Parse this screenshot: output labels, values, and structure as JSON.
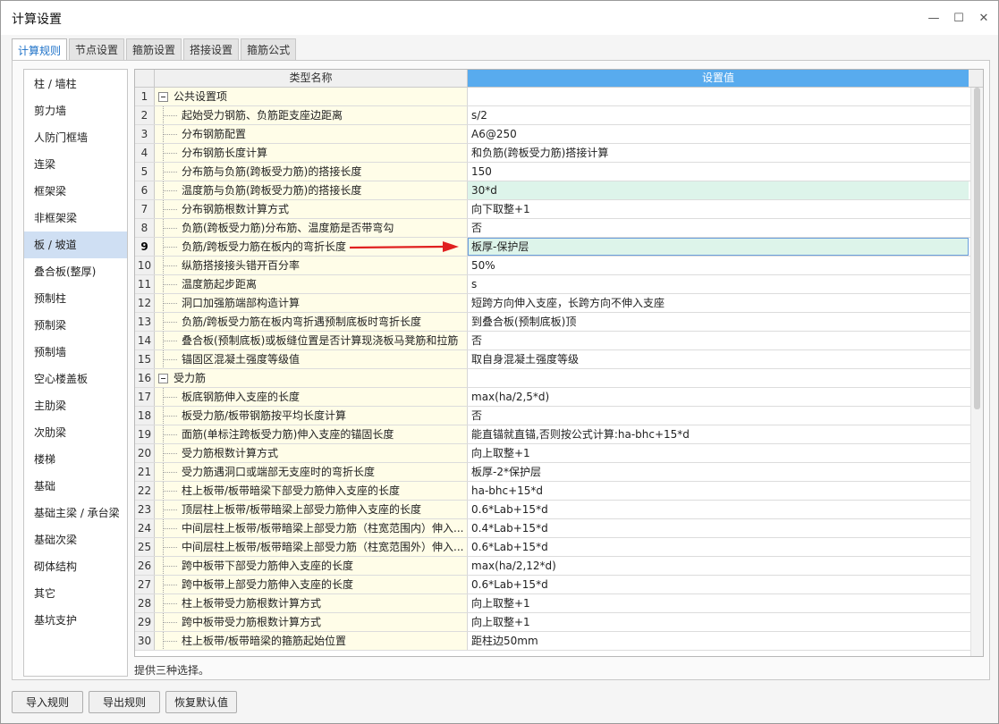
{
  "window": {
    "title": "计算设置",
    "minimize": "—",
    "maximize": "☐",
    "close": "✕"
  },
  "tabs": [
    {
      "label": "计算规则",
      "active": true
    },
    {
      "label": "节点设置",
      "active": false
    },
    {
      "label": "箍筋设置",
      "active": false
    },
    {
      "label": "搭接设置",
      "active": false
    },
    {
      "label": "箍筋公式",
      "active": false
    }
  ],
  "sidebar": {
    "items": [
      "柱 / 墙柱",
      "剪力墙",
      "人防门框墙",
      "连梁",
      "框架梁",
      "非框架梁",
      "板 / 坡道",
      "叠合板(整厚)",
      "预制柱",
      "预制梁",
      "预制墙",
      "空心楼盖板",
      "主肋梁",
      "次肋梁",
      "楼梯",
      "基础",
      "基础主梁 / 承台梁",
      "基础次梁",
      "砌体结构",
      "其它",
      "基坑支护"
    ],
    "active_index": 6
  },
  "grid": {
    "header_name": "类型名称",
    "header_value": "设置值",
    "rows": [
      {
        "num": "1",
        "name": "公共设置项",
        "value": "",
        "group": true
      },
      {
        "num": "2",
        "name": "起始受力钢筋、负筋距支座边距离",
        "value": "s/2"
      },
      {
        "num": "3",
        "name": "分布钢筋配置",
        "value": "A6@250"
      },
      {
        "num": "4",
        "name": "分布钢筋长度计算",
        "value": "和负筋(跨板受力筋)搭接计算"
      },
      {
        "num": "5",
        "name": "分布筋与负筋(跨板受力筋)的搭接长度",
        "value": "150"
      },
      {
        "num": "6",
        "name": "温度筋与负筋(跨板受力筋)的搭接长度",
        "value": "30*d",
        "highlight": true
      },
      {
        "num": "7",
        "name": "分布钢筋根数计算方式",
        "value": "向下取整+1"
      },
      {
        "num": "8",
        "name": "负筋(跨板受力筋)分布筋、温度筋是否带弯勾",
        "value": "否"
      },
      {
        "num": "9",
        "name": "负筋/跨板受力筋在板内的弯折长度",
        "value": "板厚-保护层",
        "selected": true
      },
      {
        "num": "10",
        "name": "纵筋搭接接头错开百分率",
        "value": "50%"
      },
      {
        "num": "11",
        "name": "温度筋起步距离",
        "value": "s"
      },
      {
        "num": "12",
        "name": "洞口加强筋端部构造计算",
        "value": "短跨方向伸入支座，长跨方向不伸入支座"
      },
      {
        "num": "13",
        "name": "负筋/跨板受力筋在板内弯折遇预制底板时弯折长度",
        "value": "到叠合板(预制底板)顶"
      },
      {
        "num": "14",
        "name": "叠合板(预制底板)或板缝位置是否计算现浇板马凳筋和拉筋",
        "value": "否"
      },
      {
        "num": "15",
        "name": "锚固区混凝土强度等级值",
        "value": "取自身混凝土强度等级"
      },
      {
        "num": "16",
        "name": "受力筋",
        "value": "",
        "group": true
      },
      {
        "num": "17",
        "name": "板底钢筋伸入支座的长度",
        "value": "max(ha/2,5*d)"
      },
      {
        "num": "18",
        "name": "板受力筋/板带钢筋按平均长度计算",
        "value": "否"
      },
      {
        "num": "19",
        "name": "面筋(单标注跨板受力筋)伸入支座的锚固长度",
        "value": "能直锚就直锚,否则按公式计算:ha-bhc+15*d"
      },
      {
        "num": "20",
        "name": "受力筋根数计算方式",
        "value": "向上取整+1"
      },
      {
        "num": "21",
        "name": "受力筋遇洞口或端部无支座时的弯折长度",
        "value": "板厚-2*保护层"
      },
      {
        "num": "22",
        "name": "柱上板带/板带暗梁下部受力筋伸入支座的长度",
        "value": "ha-bhc+15*d"
      },
      {
        "num": "23",
        "name": "顶层柱上板带/板带暗梁上部受力筋伸入支座的长度",
        "value": "0.6*Lab+15*d"
      },
      {
        "num": "24",
        "name": "中间层柱上板带/板带暗梁上部受力筋（柱宽范围内）伸入...",
        "value": "0.4*Lab+15*d"
      },
      {
        "num": "25",
        "name": "中间层柱上板带/板带暗梁上部受力筋（柱宽范围外）伸入...",
        "value": "0.6*Lab+15*d"
      },
      {
        "num": "26",
        "name": "跨中板带下部受力筋伸入支座的长度",
        "value": "max(ha/2,12*d)"
      },
      {
        "num": "27",
        "name": "跨中板带上部受力筋伸入支座的长度",
        "value": "0.6*Lab+15*d"
      },
      {
        "num": "28",
        "name": "柱上板带受力筋根数计算方式",
        "value": "向上取整+1"
      },
      {
        "num": "29",
        "name": "跨中板带受力筋根数计算方式",
        "value": "向上取整+1"
      },
      {
        "num": "30",
        "name": "柱上板带/板带暗梁的箍筋起始位置",
        "value": "距柱边50mm"
      }
    ]
  },
  "status_text": "提供三种选择。",
  "buttons": {
    "import": "导入规则",
    "export": "导出规则",
    "restore": "恢复默认值"
  },
  "colors": {
    "accent": "#1e72c8",
    "header_value_bg": "#58abee",
    "name_cell_bg": "#fffde8",
    "highlight_bg": "#ddf4ea",
    "arrow": "#e02020"
  }
}
